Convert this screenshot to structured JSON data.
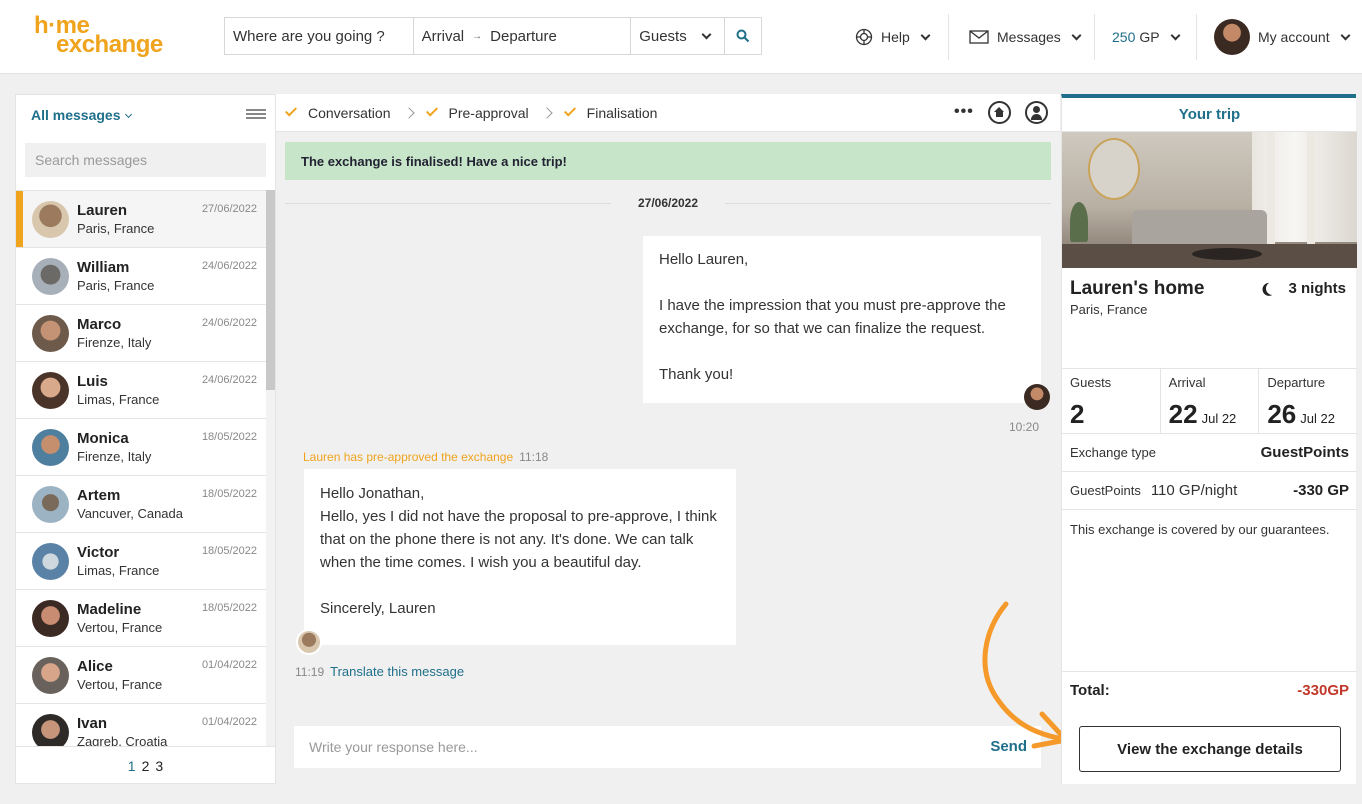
{
  "header": {
    "logo_line1": "h·me",
    "logo_line2": "exchange",
    "search": {
      "where_placeholder": "Where are you going ?",
      "arrival": "Arrival",
      "departure": "Departure",
      "guests": "Guests"
    },
    "help": "Help",
    "messages": "Messages",
    "gp_amount": "250",
    "gp_unit": "GP",
    "account": "My account"
  },
  "sidebar": {
    "filter_label": "All messages",
    "search_placeholder": "Search messages",
    "conversations": [
      {
        "name": "Lauren",
        "location": "Paris, France",
        "date": "27/06/2022",
        "active": true
      },
      {
        "name": "William",
        "location": "Paris, France",
        "date": "24/06/2022"
      },
      {
        "name": "Marco",
        "location": "Firenze, Italy",
        "date": "24/06/2022"
      },
      {
        "name": "Luis",
        "location": "Limas, France",
        "date": "24/06/2022"
      },
      {
        "name": "Monica",
        "location": "Firenze, Italy",
        "date": "18/05/2022"
      },
      {
        "name": "Artem",
        "location": "Vancuver, Canada",
        "date": "18/05/2022"
      },
      {
        "name": "Victor",
        "location": "Limas, France",
        "date": "18/05/2022"
      },
      {
        "name": "Madeline",
        "location": "Vertou, France",
        "date": "18/05/2022"
      },
      {
        "name": "Alice",
        "location": "Vertou, France",
        "date": "01/04/2022"
      },
      {
        "name": "Ivan",
        "location": "Zagreb, Croatia",
        "date": "01/04/2022"
      }
    ],
    "pages": [
      "1",
      "2",
      "3"
    ]
  },
  "conversation": {
    "steps": [
      "Conversation",
      "Pre-approval",
      "Finalisation"
    ],
    "more": "•••",
    "banner": "The exchange is finalised! Have a nice trip!",
    "date": "27/06/2022",
    "my_message": {
      "p1": "Hello Lauren,",
      "p2": "I have the impression that you must pre-approve the exchange, for so that we can finalize the request.",
      "p3": "Thank you!",
      "time": "10:20"
    },
    "preapproval_note": "Lauren has pre-approved the exchange",
    "preapproval_time": "11:18",
    "lauren_message": {
      "p1": "Hello Jonathan,\nHello, yes I did not have the proposal to pre-approve, I think that on the phone there is not any. It's done. We can talk when the time comes. I wish you a beautiful day.",
      "p2": "Sincerely, Lauren",
      "time": "11:19"
    },
    "translate": "Translate this message",
    "reply_placeholder": "Write your response here...",
    "send": "Send"
  },
  "trip": {
    "title": "Your trip",
    "home_name": "Lauren's home",
    "location": "Paris, France",
    "nights": "3 nights",
    "guests_label": "Guests",
    "guests": "2",
    "arrival_label": "Arrival",
    "arrival_day": "22",
    "arrival_month": "Jul 22",
    "departure_label": "Departure",
    "departure_day": "26",
    "departure_month": "Jul 22",
    "exchange_type_label": "Exchange type",
    "exchange_type": "GuestPoints",
    "gp_label": "GuestPoints",
    "gp_rate": "110 GP/night",
    "gp_total": "-330 GP",
    "covered": "This exchange is covered by our guarantees.",
    "total_label": "Total:",
    "total": "-330GP",
    "details_button": "View the exchange details"
  },
  "colors": {
    "brand_orange": "#f0a31c",
    "accent_teal": "#1f6f8b",
    "success_bg": "#c7e6c9",
    "negative": "#c0392b"
  }
}
